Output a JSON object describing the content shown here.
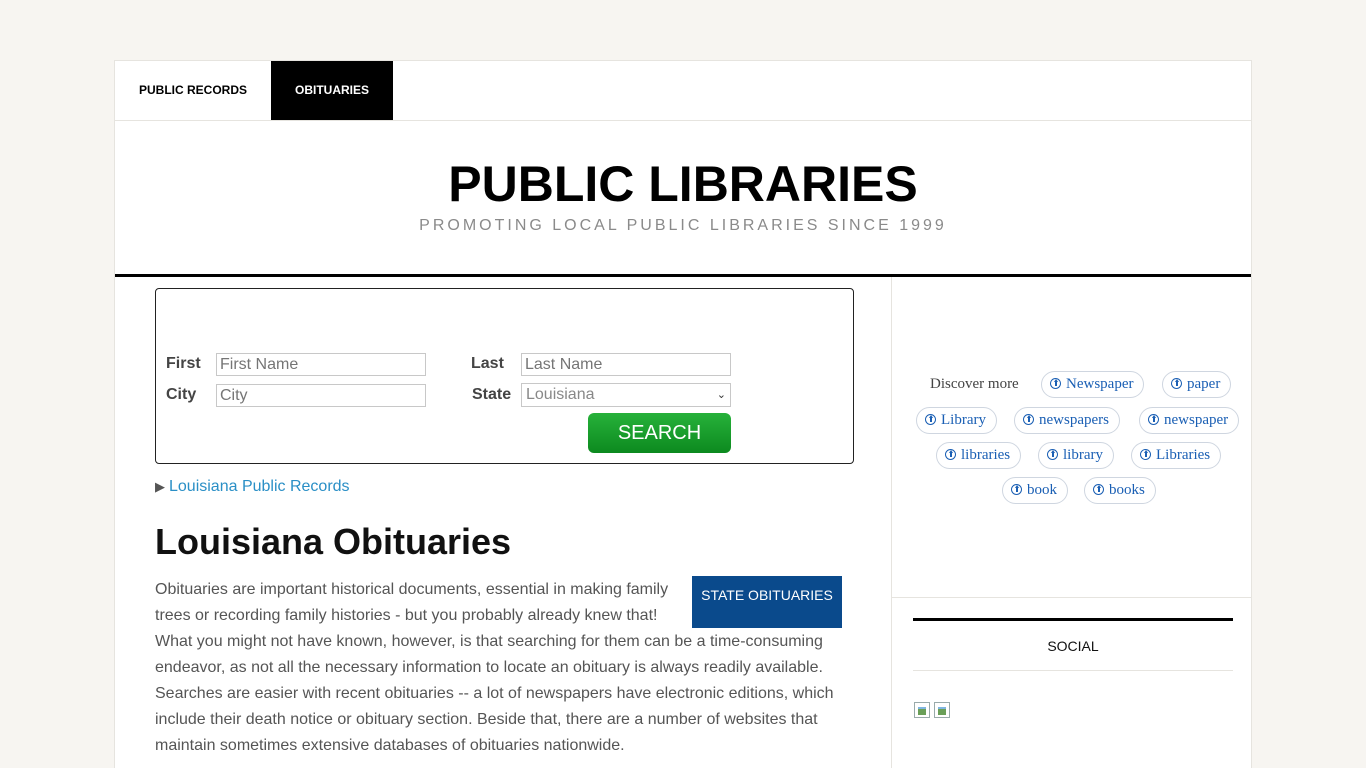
{
  "nav": {
    "public_records": "PUBLIC RECORDS",
    "obituaries": "OBITUARIES"
  },
  "header": {
    "title": "PUBLIC LIBRARIES",
    "tagline": "PROMOTING LOCAL PUBLIC LIBRARIES SINCE 1999"
  },
  "search": {
    "first_label": "First",
    "first_placeholder": "First Name",
    "last_label": "Last",
    "last_placeholder": "Last Name",
    "city_label": "City",
    "city_placeholder": "City",
    "state_label": "State",
    "state_selected": "Louisiana",
    "button": "SEARCH"
  },
  "records_link": "Louisiana Public Records",
  "main": {
    "title": "Louisiana Obituaries",
    "state_button": "STATE OBITUARIES",
    "intro": "Obituaries are important historical documents, essential in making family trees or recording family histories - but you probably already knew that! What you might not have known, however, is that searching for them can be a time-consuming endeavor, as not all the necessary information to locate an obituary is always readily available. Searches are easier with recent obituaries -- a lot of newspapers have electronic editions, which include their death notice or obituary section. Beside that, there are a number of websites that maintain sometimes extensive databases of obituaries nationwide."
  },
  "sidebar": {
    "discover_label": "Discover more",
    "pills": [
      "Newspaper",
      "paper",
      "Library",
      "newspapers",
      "newspaper",
      "libraries",
      "library",
      "Libraries",
      "book",
      "books"
    ],
    "social_title": "SOCIAL"
  },
  "colors": {
    "accent_link": "#2a8fc6",
    "search_button": "#17a02c",
    "state_button": "#0a4a8c",
    "pill_text": "#1a5fb4"
  }
}
